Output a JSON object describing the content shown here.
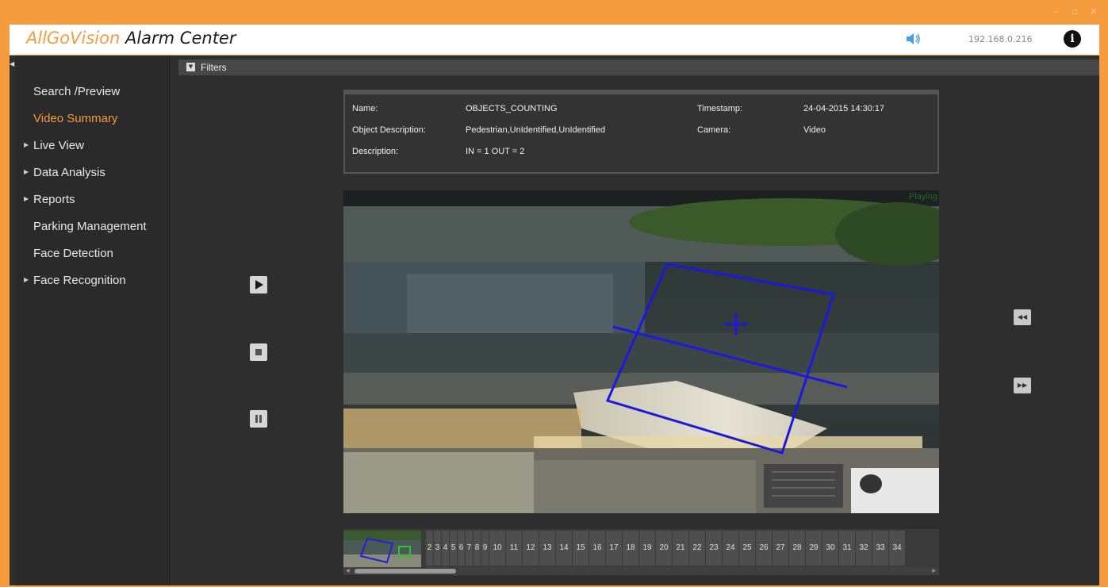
{
  "window": {
    "title_brand": "AllGoVision",
    "title_rest": " Alarm Center",
    "ip": "192.168.0.216",
    "controls": [
      "–",
      "▫",
      "✕"
    ]
  },
  "sidebar": {
    "items": [
      {
        "label": "Search /Preview",
        "arrow": false,
        "active": false
      },
      {
        "label": "Video Summary",
        "arrow": false,
        "active": true
      },
      {
        "label": "Live View",
        "arrow": true,
        "active": false
      },
      {
        "label": "Data Analysis",
        "arrow": true,
        "active": false
      },
      {
        "label": "Reports",
        "arrow": true,
        "active": false
      },
      {
        "label": "Parking Management",
        "arrow": false,
        "active": false
      },
      {
        "label": "Face Detection",
        "arrow": false,
        "active": false
      },
      {
        "label": "Face Recognition",
        "arrow": true,
        "active": false
      }
    ]
  },
  "filters": {
    "label": "Filters"
  },
  "event": {
    "name_label": "Name:",
    "name_value": "OBJECTS_COUNTING",
    "objdesc_label": "Object Description:",
    "objdesc_value": "Pedestrian,UnIdentified,UnIdentified",
    "desc_label": "Description:",
    "desc_value": "IN = 1 OUT = 2",
    "timestamp_label": "Timestamp:",
    "timestamp_value": "24-04-2015 14:30:17",
    "camera_label": "Camera:",
    "camera_value": "Video"
  },
  "video": {
    "status": "Playing"
  },
  "filmstrip": {
    "frames": [
      "2",
      "3",
      "4",
      "5",
      "6",
      "7",
      "8",
      "9",
      "10",
      "11",
      "12",
      "13",
      "14",
      "15",
      "16",
      "17",
      "18",
      "19",
      "20",
      "21",
      "22",
      "23",
      "24",
      "25",
      "26",
      "27",
      "28",
      "29",
      "30",
      "31",
      "32",
      "33",
      "34"
    ]
  },
  "icons": {
    "speaker": "speaker-icon",
    "info": "info-icon",
    "play": "play-icon",
    "stop": "stop-icon",
    "pause": "pause-icon",
    "rewind": "rewind-icon",
    "forward": "fast-forward-icon"
  },
  "colors": {
    "accent": "#f59c3f",
    "detection": "#1a1adc"
  }
}
